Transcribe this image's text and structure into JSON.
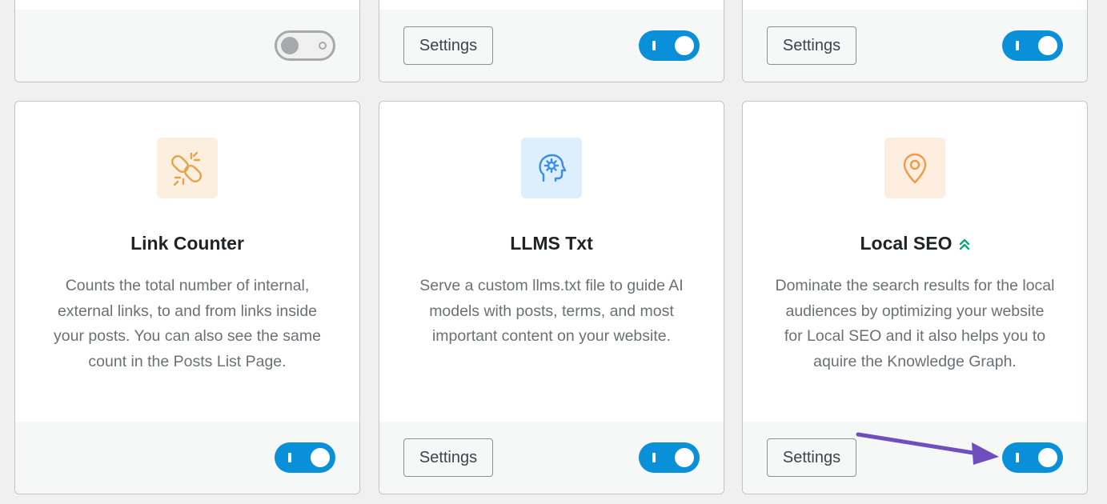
{
  "top_row": [
    {
      "toggle_state": "off",
      "has_settings": false
    },
    {
      "toggle_state": "on",
      "has_settings": true,
      "settings_label": "Settings"
    },
    {
      "toggle_state": "on",
      "has_settings": true,
      "settings_label": "Settings"
    }
  ],
  "modules": [
    {
      "icon": "broken-link-icon",
      "title": "Link Counter",
      "description": "Counts the total number of internal, external links, to and from links inside your posts. You can also see the same count in the Posts List Page.",
      "toggle_state": "on",
      "has_settings": false
    },
    {
      "icon": "ai-head-icon",
      "title": "LLMS Txt",
      "description": "Serve a custom llms.txt file to guide AI models with posts, terms, and most important content on your website.",
      "toggle_state": "on",
      "has_settings": true,
      "settings_label": "Settings"
    },
    {
      "icon": "map-pin-icon",
      "title": "Local SEO",
      "badge_icon": "pro-chevrons-icon",
      "description": "Dominate the search results for the local audiences by optimizing your website for Local SEO and it also helps you to aquire the Knowledge Graph.",
      "toggle_state": "on",
      "has_settings": true,
      "settings_label": "Settings"
    }
  ],
  "colors": {
    "toggle_on": "#0a8fd9",
    "annotation_arrow": "#6f4fbf",
    "pro_badge": "#10a37f"
  }
}
